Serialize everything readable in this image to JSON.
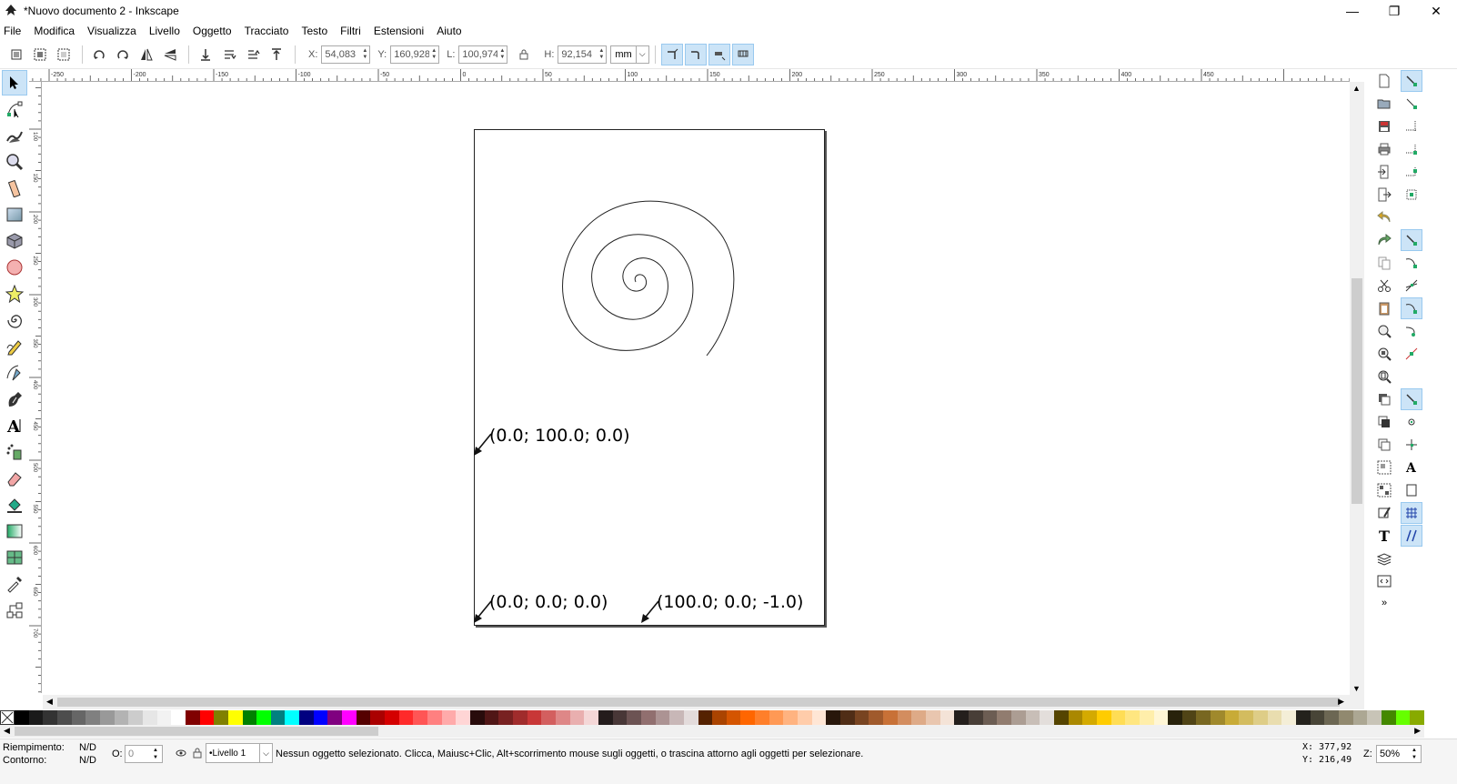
{
  "window": {
    "title": "*Nuovo documento 2 - Inkscape"
  },
  "menu": [
    "File",
    "Modifica",
    "Visualizza",
    "Livello",
    "Oggetto",
    "Tracciato",
    "Testo",
    "Filtri",
    "Estensioni",
    "Aiuto"
  ],
  "toolbar": {
    "x_label": "X:",
    "x_value": "54,083",
    "y_label": "Y:",
    "y_value": "160,928",
    "w_label": "L:",
    "w_value": "100,974",
    "h_label": "H:",
    "h_value": "92,154",
    "unit": "mm"
  },
  "ruler_top": {
    "labels": [
      "-250",
      "-200",
      "-150",
      "-100",
      "-50",
      "0",
      "50",
      "100",
      "150",
      "200",
      "250",
      "300",
      "350",
      "400",
      "450"
    ]
  },
  "ruler_left": {
    "labels": [
      "100",
      "150",
      "200",
      "250",
      "300",
      "350",
      "400",
      "450",
      "500",
      "550",
      "600",
      "650",
      "700"
    ]
  },
  "canvas": {
    "labels": [
      {
        "text": "(0.0; 100.0; 0.0)"
      },
      {
        "text": "(0.0; 0.0; 0.0)"
      },
      {
        "text": "(100.0; 0.0; -1.0)"
      }
    ]
  },
  "palette": [
    "#000000",
    "#1a1a1a",
    "#333333",
    "#4d4d4d",
    "#666666",
    "#808080",
    "#999999",
    "#b3b3b3",
    "#cccccc",
    "#e6e6e6",
    "#f2f2f2",
    "#ffffff",
    "#800000",
    "#ff0000",
    "#808000",
    "#ffff00",
    "#008000",
    "#00ff00",
    "#008080",
    "#00ffff",
    "#000080",
    "#0000ff",
    "#800080",
    "#ff00ff",
    "#550000",
    "#aa0000",
    "#d40000",
    "#ff2a2a",
    "#ff5555",
    "#ff8080",
    "#ffaaaa",
    "#ffd5d5",
    "#280b0b",
    "#501616",
    "#782121",
    "#a02c2c",
    "#c83737",
    "#d35f5f",
    "#de8787",
    "#e9afaf",
    "#f4d7d7",
    "#241c1c",
    "#483737",
    "#6c5353",
    "#916f6f",
    "#ac9393",
    "#c8b7b7",
    "#e3dbdb",
    "#552200",
    "#aa4400",
    "#d45500",
    "#ff6600",
    "#ff7f2a",
    "#ff9955",
    "#ffb380",
    "#ffccaa",
    "#ffe6d5",
    "#28170b",
    "#502d16",
    "#784421",
    "#a05a2c",
    "#c87137",
    "#d38d5f",
    "#deaa87",
    "#e9c6af",
    "#f4e3d7",
    "#241f1c",
    "#483e37",
    "#6c5d53",
    "#917c6f",
    "#ac9d93",
    "#c8beb7",
    "#e3dedb",
    "#554400",
    "#aa8800",
    "#d4aa00",
    "#ffcc00",
    "#ffdd55",
    "#ffe680",
    "#ffeeaa",
    "#fff6d5",
    "#28220b",
    "#504416",
    "#786721",
    "#a0892c",
    "#c8ab37",
    "#d3bc5f",
    "#decd87",
    "#e9ddaf",
    "#f4eed7",
    "#24221c",
    "#484537",
    "#6c6753",
    "#91896f",
    "#aca793",
    "#c8c4b7",
    "#448800",
    "#66ff00",
    "#88aa00"
  ],
  "status": {
    "fill_label": "Riempimento:",
    "fill_value": "N/D",
    "stroke_label": "Contorno:",
    "stroke_value": "N/D",
    "opacity_label": "O:",
    "opacity_value": "0",
    "layer": "•Livello 1",
    "message": "Nessun oggetto selezionato. Clicca, Maiusc+Clic, Alt+scorrimento mouse sugli oggetti, o trascina attorno agli oggetti per selezionare.",
    "cursor_x": "X:  377,92",
    "cursor_y": "Y:  216,49",
    "zoom_label": "Z:",
    "zoom_value": "50%"
  }
}
